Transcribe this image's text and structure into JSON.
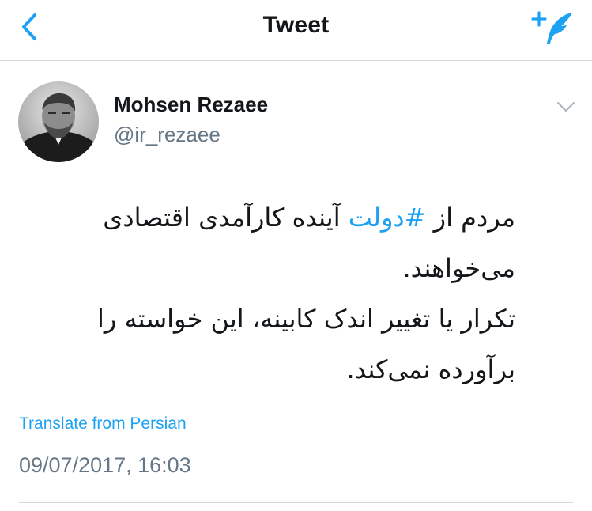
{
  "nav": {
    "title": "Tweet",
    "back_icon": "chevron-left-icon",
    "compose_icon": "compose-quill-plus-icon",
    "accent": "#1da1f2"
  },
  "author": {
    "name": "Mohsen Rezaee",
    "handle": "@ir_rezaee",
    "avatar_icon": "profile-photo-avatar"
  },
  "tweet": {
    "line1_prefix": "مردم از ",
    "hashtag": "#دولت",
    "line1_suffix": " آینده کارآمدی اقتصادی",
    "line2": "می‌خواهند.",
    "line3": "تکرار یا تغییر اندک کابینه، این خواسته را",
    "line4": "برآورده نمی‌کند."
  },
  "translate_label": "Translate from Persian",
  "timestamp": "09/07/2017, 16:03",
  "colors": {
    "text": "#14171a",
    "secondary": "#657786",
    "link": "#1da1f2",
    "divider": "#d4d6d8"
  }
}
